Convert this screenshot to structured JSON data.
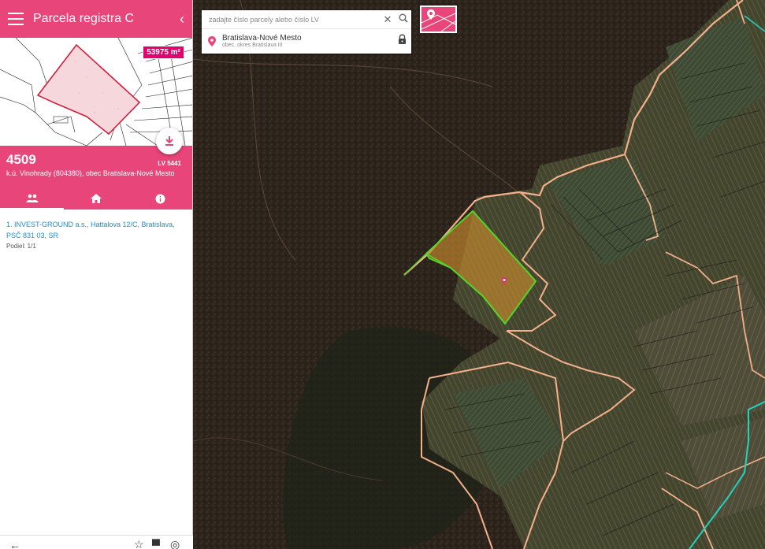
{
  "app": {
    "title": "Parcela registra C"
  },
  "parcel": {
    "number": "4509",
    "lv": "LV 5441",
    "area": "53975 m²",
    "cadastral": "k.ú. Vinohrady (804380), obec Bratislava-Nové Mesto"
  },
  "tabs": [
    {
      "name": "owners",
      "icon": "people-icon",
      "active": true
    },
    {
      "name": "building",
      "icon": "home-icon",
      "active": false
    },
    {
      "name": "info",
      "icon": "info-icon",
      "active": false
    }
  ],
  "owners": [
    {
      "line1": "1. INVEST-GROUND a.s., Hattalova 12/C, Bratislava,",
      "line2": "PSČ 831 03, SR",
      "share": "Podiel: 1/1"
    }
  ],
  "search": {
    "placeholder": "zadajte číslo parcely alebo číslo LV",
    "value": "",
    "location_name": "Bratislava-Nové Mesto",
    "location_sub": "obec, okres Bratislava III"
  },
  "colors": {
    "accent": "#e8457a",
    "link": "#1f8fcb",
    "parcel_highlight": "#55d42a",
    "boundary": "#f3b08a",
    "cadastral_line": "#22d3c0"
  },
  "icons": {
    "menu": "menu-icon",
    "collapse": "chevron-left-icon",
    "download": "download-icon",
    "clear": "close-icon",
    "search": "search-icon",
    "pin": "location-pin-icon",
    "lock": "lock-icon",
    "layers": "map-layer-icon",
    "back": "arrow-left-icon",
    "favorite": "star-icon",
    "print": "print-icon",
    "locate": "gps-icon"
  }
}
